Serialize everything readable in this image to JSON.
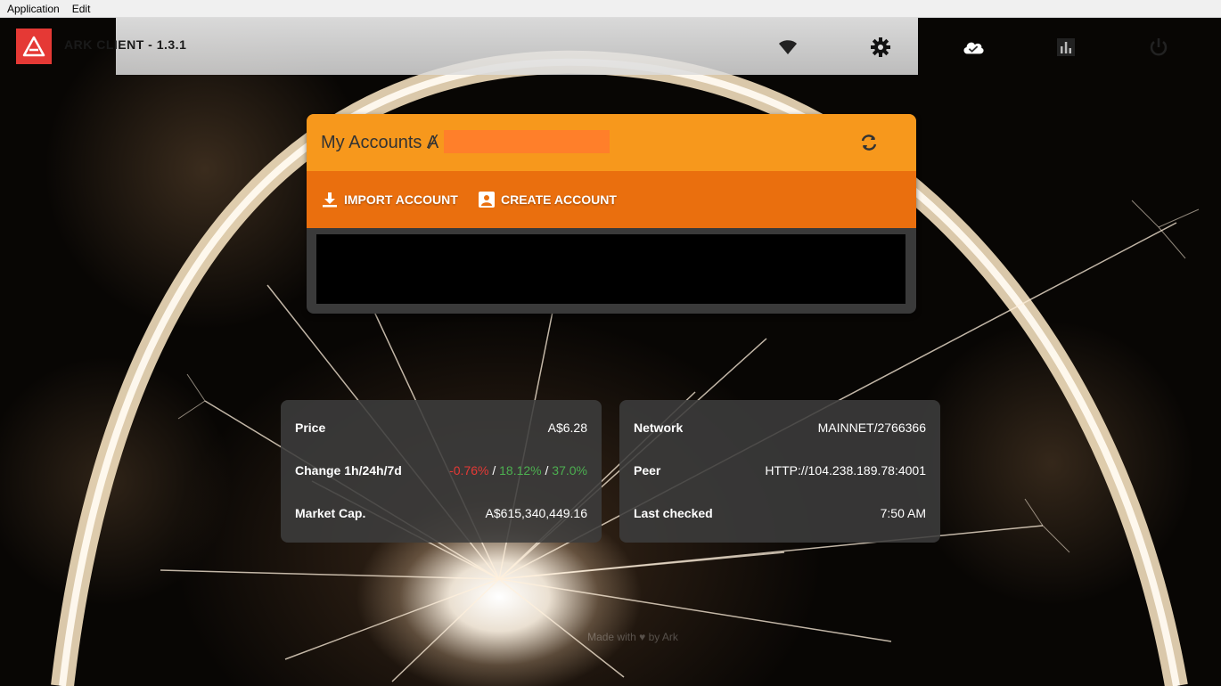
{
  "menubar": {
    "items": [
      "Application",
      "Edit"
    ]
  },
  "app": {
    "title": "ARK CLIENT - 1.3.1",
    "accent": "#e53935"
  },
  "header": {
    "icons": [
      "wifi-icon",
      "gear-icon",
      "cloud-check-icon",
      "bar-chart-icon",
      "power-icon"
    ]
  },
  "accounts": {
    "title": "My Accounts Ⱥ",
    "import_label": "IMPORT ACCOUNT",
    "create_label": "CREATE ACCOUNT",
    "header_color": "#f7981c",
    "actions_color": "#ea6f0e"
  },
  "market": {
    "price_label": "Price",
    "price_value": "A$6.28",
    "change_label": "Change 1h/24h/7d",
    "change_1h": "-0.76%",
    "change_24h": "18.12%",
    "change_7d": "37.0%",
    "change_sep": " / ",
    "marketcap_label": "Market Cap.",
    "marketcap_value": "A$615,340,449.16"
  },
  "network": {
    "network_label": "Network",
    "network_value": "MAINNET/2766366",
    "peer_label": "Peer",
    "peer_value": "HTTP://104.238.189.78:4001",
    "checked_label": "Last checked",
    "checked_value": "7:50 AM"
  },
  "footer": {
    "text": "Made with ♥ by Ark"
  }
}
